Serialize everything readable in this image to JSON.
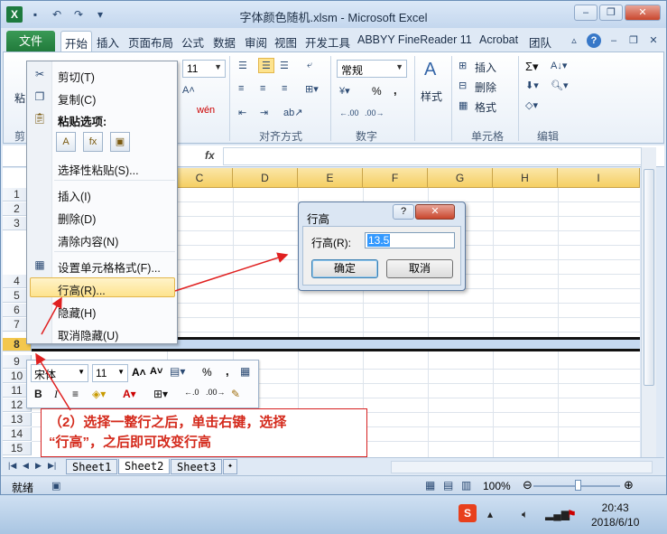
{
  "window": {
    "title": "字体颜色随机.xlsm - Microsoft Excel",
    "app_icon": "X"
  },
  "ribbon_tabs": [
    "文件",
    "开始",
    "插入",
    "页面布局",
    "公式",
    "数据",
    "审阅",
    "视图",
    "开发工具",
    "ABBYY FineReader 11",
    "Acrobat",
    "团队"
  ],
  "ribbon": {
    "font_size": "11",
    "number_format": "常规",
    "percent": "%",
    "comma": ",",
    "style_label": "样式",
    "insert": "插入",
    "delete": "删除",
    "format": "格式",
    "group_alignment": "对齐方式",
    "group_number": "数字",
    "group_cells": "单元格",
    "group_edit": "编辑",
    "partial_paste": "粘",
    "partial_clipboard": "剪"
  },
  "formula_bar": {
    "fx": "fx",
    "value": ""
  },
  "grid": {
    "columns": [
      "C",
      "D",
      "E",
      "F",
      "G",
      "H",
      "I"
    ],
    "rows": [
      "1",
      "2",
      "3",
      "4",
      "5",
      "6",
      "7",
      "8",
      "9",
      "10",
      "11",
      "12",
      "13",
      "14",
      "15"
    ],
    "selected_row": "8"
  },
  "context_menu": {
    "cut": "剪切(T)",
    "copy": "复制(C)",
    "paste_options": "粘贴选项:",
    "paste_special": "选择性粘贴(S)...",
    "insert": "插入(I)",
    "delete": "删除(D)",
    "clear": "清除内容(N)",
    "format_cells": "设置单元格格式(F)...",
    "row_height": "行高(R)...",
    "hide": "隐藏(H)",
    "unhide": "取消隐藏(U)"
  },
  "mini_toolbar": {
    "font": "宋体",
    "size": "11",
    "bold": "B",
    "italic": "I",
    "percent": "%",
    "comma": ","
  },
  "dialog": {
    "title": "行高",
    "help": "?",
    "label": "行高(R):",
    "value": "13.5",
    "ok": "确定",
    "cancel": "取消"
  },
  "annotation": {
    "line1": "（2）选择一整行之后，单击右键，选择",
    "line2": "“行高”，之后即可改变行高"
  },
  "sheets": [
    "Sheet1",
    "Sheet2",
    "Sheet3"
  ],
  "active_sheet": "Sheet2",
  "status": {
    "ready": "就绪",
    "zoom": "100%"
  },
  "taskbar": {
    "time": "20:43",
    "date": "2018/6/10"
  },
  "colors": {
    "accent": "#217a3b",
    "annotation": "#d42a1c",
    "selection": "#c5d9f1"
  }
}
